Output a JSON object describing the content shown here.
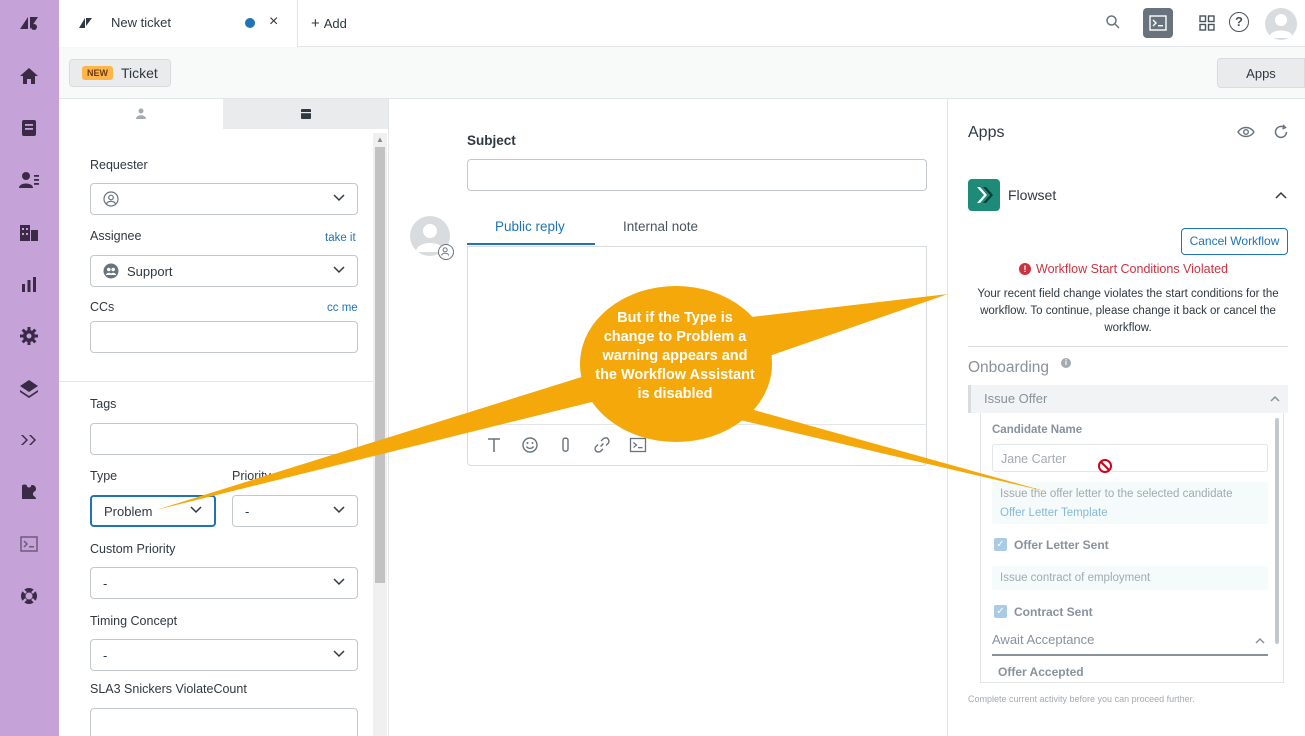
{
  "topbar": {
    "tab_title": "New ticket",
    "tab_close": "×",
    "add_label": "Add",
    "add_plus": "+",
    "help_label": "?"
  },
  "subbar": {
    "badge": "NEW",
    "ticket_label": "Ticket",
    "apps_button": "Apps"
  },
  "fields": {
    "requester_label": "Requester",
    "assignee_label": "Assignee",
    "assignee_link": "take it",
    "assignee_value": "Support",
    "ccs_label": "CCs",
    "ccs_link": "cc me",
    "tags_label": "Tags",
    "type_label": "Type",
    "type_value": "Problem",
    "priority_label": "Priority",
    "priority_value": "-",
    "custom_priority_label": "Custom Priority",
    "custom_priority_value": "-",
    "timing_label": "Timing Concept",
    "timing_value": "-",
    "sla_label": "SLA3 Snickers ViolateCount"
  },
  "conversation": {
    "subject_label": "Subject",
    "tab_public": "Public reply",
    "tab_internal": "Internal note"
  },
  "apps_panel": {
    "title": "Apps",
    "app_name": "Flowset",
    "cancel_workflow": "Cancel Workflow",
    "warning_title": "Workflow Start Conditions Violated",
    "warning_mark": "!",
    "warning_body": "Your recent field change violates the start conditions for the workflow. To continue, please change it back or cancel the workflow.",
    "workflow_name": "Onboarding",
    "info_mark": "i",
    "stage1": "Issue Offer",
    "candidate_label": "Candidate Name",
    "candidate_value": "Jane Carter",
    "task1_text": "Issue the offer letter to the selected candidate",
    "task1_link": "Offer Letter Template",
    "check1": "Offer Letter Sent",
    "task2_text": "Issue contract of employment",
    "check2": "Contract Sent",
    "check_mark": "✓",
    "stage2": "Await Acceptance",
    "offer_accepted": "Offer Accepted",
    "footnote": "Complete current activity before you can proceed further."
  },
  "callout": {
    "text": "But if the Type is change to Problem a warning appears and the Workflow Assistant is disabled"
  },
  "colors": {
    "rail": "#c5a2d8",
    "callout": "#f5a80a",
    "accent": "#1f73b7",
    "warning": "#cc3340",
    "flowset": "#1d8b78"
  }
}
